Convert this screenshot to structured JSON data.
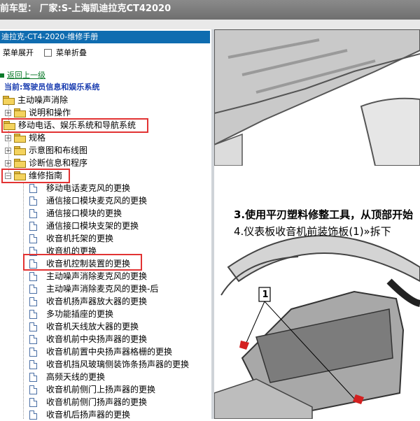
{
  "header": {
    "text": "前车型：  厂家:S-上海凯迪拉克CT42020"
  },
  "manual": {
    "title": "迪拉克-CT4-2020-维修手册"
  },
  "toolbar": {
    "expand_label": "菜单展开",
    "collapse_label": "菜单折叠"
  },
  "nav": {
    "back_label": "返回上一级",
    "current_label": "当前:驾驶员信息和娱乐系统"
  },
  "tree": {
    "root": "主动噪声消除",
    "folders": [
      "说明和操作",
      "移动电话、娱乐系统和导航系统",
      "规格",
      "示意图和布线图",
      "诊断信息和程序",
      "维修指南"
    ],
    "docs": [
      "移动电话麦克风的更换",
      "通信接口模块麦克风的更换",
      "通信接口模块的更换",
      "通信接口模块支架的更换",
      "收音机托架的更换",
      "收音机的更换",
      "收音机控制装置的更换",
      "主动噪声消除麦克风的更换",
      "主动噪声消除麦克风的更换-后",
      "收音机扬声器放大器的更换",
      "多功能插座的更换",
      "收音机天线放大器的更换",
      "收音机前中央扬声器的更换",
      "收音机前置中央扬声器格栅的更换",
      "收音机挡风玻璃侧装饰条扬声器的更换",
      "高频天线的更换",
      "收音机前侧门上扬声器的更换",
      "收音机前侧门扬声器的更换",
      "收音机后扬声器的更换"
    ]
  },
  "content": {
    "step3": "3.使用平刃塑料修整工具，从顶部开始",
    "step4": "4.仪表板收音机前装饰板(1)»拆下",
    "callout": "1"
  },
  "colors": {
    "title_bar": "#0f6cb0",
    "highlight": "#e23333",
    "link": "#0a7a2a",
    "current": "#1a3db0"
  }
}
